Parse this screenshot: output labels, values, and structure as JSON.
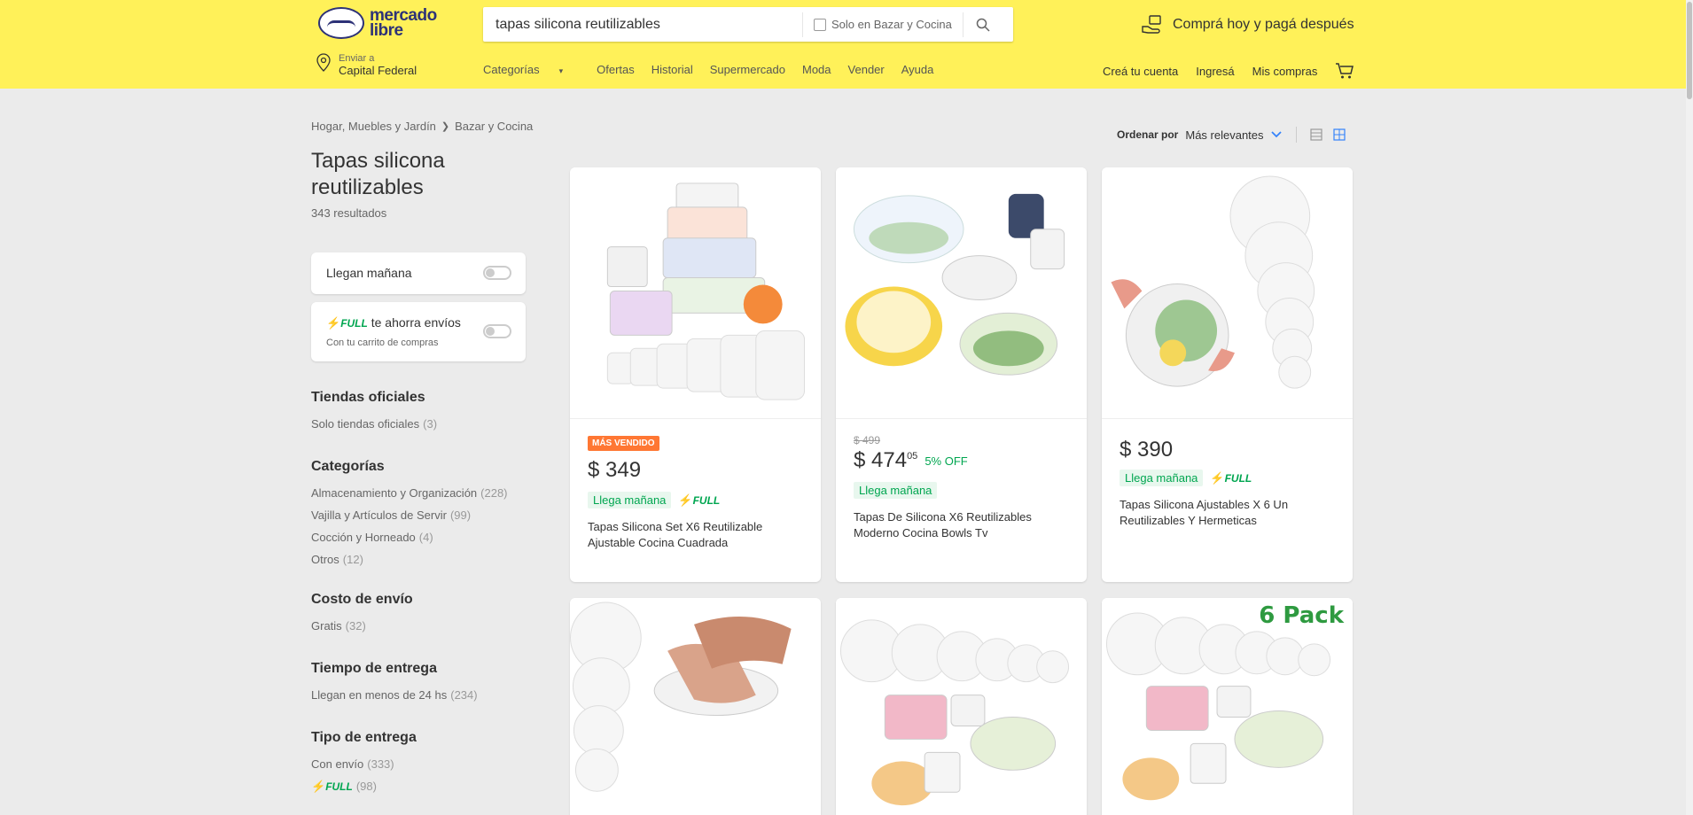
{
  "header": {
    "logo_text": "mercado libre",
    "search_value": "tapas silicona reutilizables",
    "search_filter_label": "Solo en Bazar y Cocina",
    "promo": "Comprá hoy y pagá después",
    "location_top": "Enviar a",
    "location_main": "Capital Federal",
    "nav": [
      "Categorías",
      "Ofertas",
      "Historial",
      "Supermercado",
      "Moda",
      "Vender",
      "Ayuda"
    ],
    "account": [
      "Creá tu cuenta",
      "Ingresá",
      "Mis compras"
    ]
  },
  "breadcrumb": [
    "Hogar, Muebles y Jardín",
    "Bazar y Cocina"
  ],
  "sort": {
    "label": "Ordenar por",
    "value": "Más relevantes"
  },
  "page": {
    "title": "Tapas silicona reutilizables",
    "results": "343 resultados"
  },
  "toggles": {
    "tomorrow": "Llegan mañana",
    "full_suffix": "te ahorra envíos",
    "full_sub": "Con tu carrito de compras",
    "full": "FULL"
  },
  "filters": [
    {
      "title": "Tiendas oficiales",
      "items": [
        {
          "label": "Solo tiendas oficiales",
          "count": "(3)"
        }
      ]
    },
    {
      "title": "Categorías",
      "items": [
        {
          "label": "Almacenamiento y Organización",
          "count": "(228)"
        },
        {
          "label": "Vajilla y Artículos de Servir",
          "count": "(99)"
        },
        {
          "label": "Cocción y Horneado",
          "count": "(4)"
        },
        {
          "label": "Otros",
          "count": "(12)"
        }
      ]
    },
    {
      "title": "Costo de envío",
      "items": [
        {
          "label": "Gratis",
          "count": "(32)"
        }
      ]
    },
    {
      "title": "Tiempo de entrega",
      "items": [
        {
          "label": "Llegan en menos de 24 hs",
          "count": "(234)"
        }
      ]
    },
    {
      "title": "Tipo de entrega",
      "items": [
        {
          "label": "Con envío",
          "count": "(333)"
        },
        {
          "label": "FULL",
          "count": "(98)"
        }
      ]
    }
  ],
  "products": [
    {
      "badge": "MÁS VENDIDO",
      "price": "$ 349",
      "ship": "Llega mañana",
      "full": "FULL",
      "title": "Tapas Silicona Set X6 Reutilizable Ajustable Cocina Cuadrada"
    },
    {
      "old_price": "$ 499",
      "price": "$ 474",
      "cents": "05",
      "discount": "5% OFF",
      "ship": "Llega mañana",
      "title": "Tapas De Silicona X6 Reutilizables Moderno Cocina Bowls Tv"
    },
    {
      "price": "$ 390",
      "ship": "Llega mañana",
      "full": "FULL",
      "title": "Tapas Silicona Ajustables X 6 Un Reutilizables Y Hermeticas"
    },
    {
      "pack_label": "6 Pack"
    }
  ]
}
